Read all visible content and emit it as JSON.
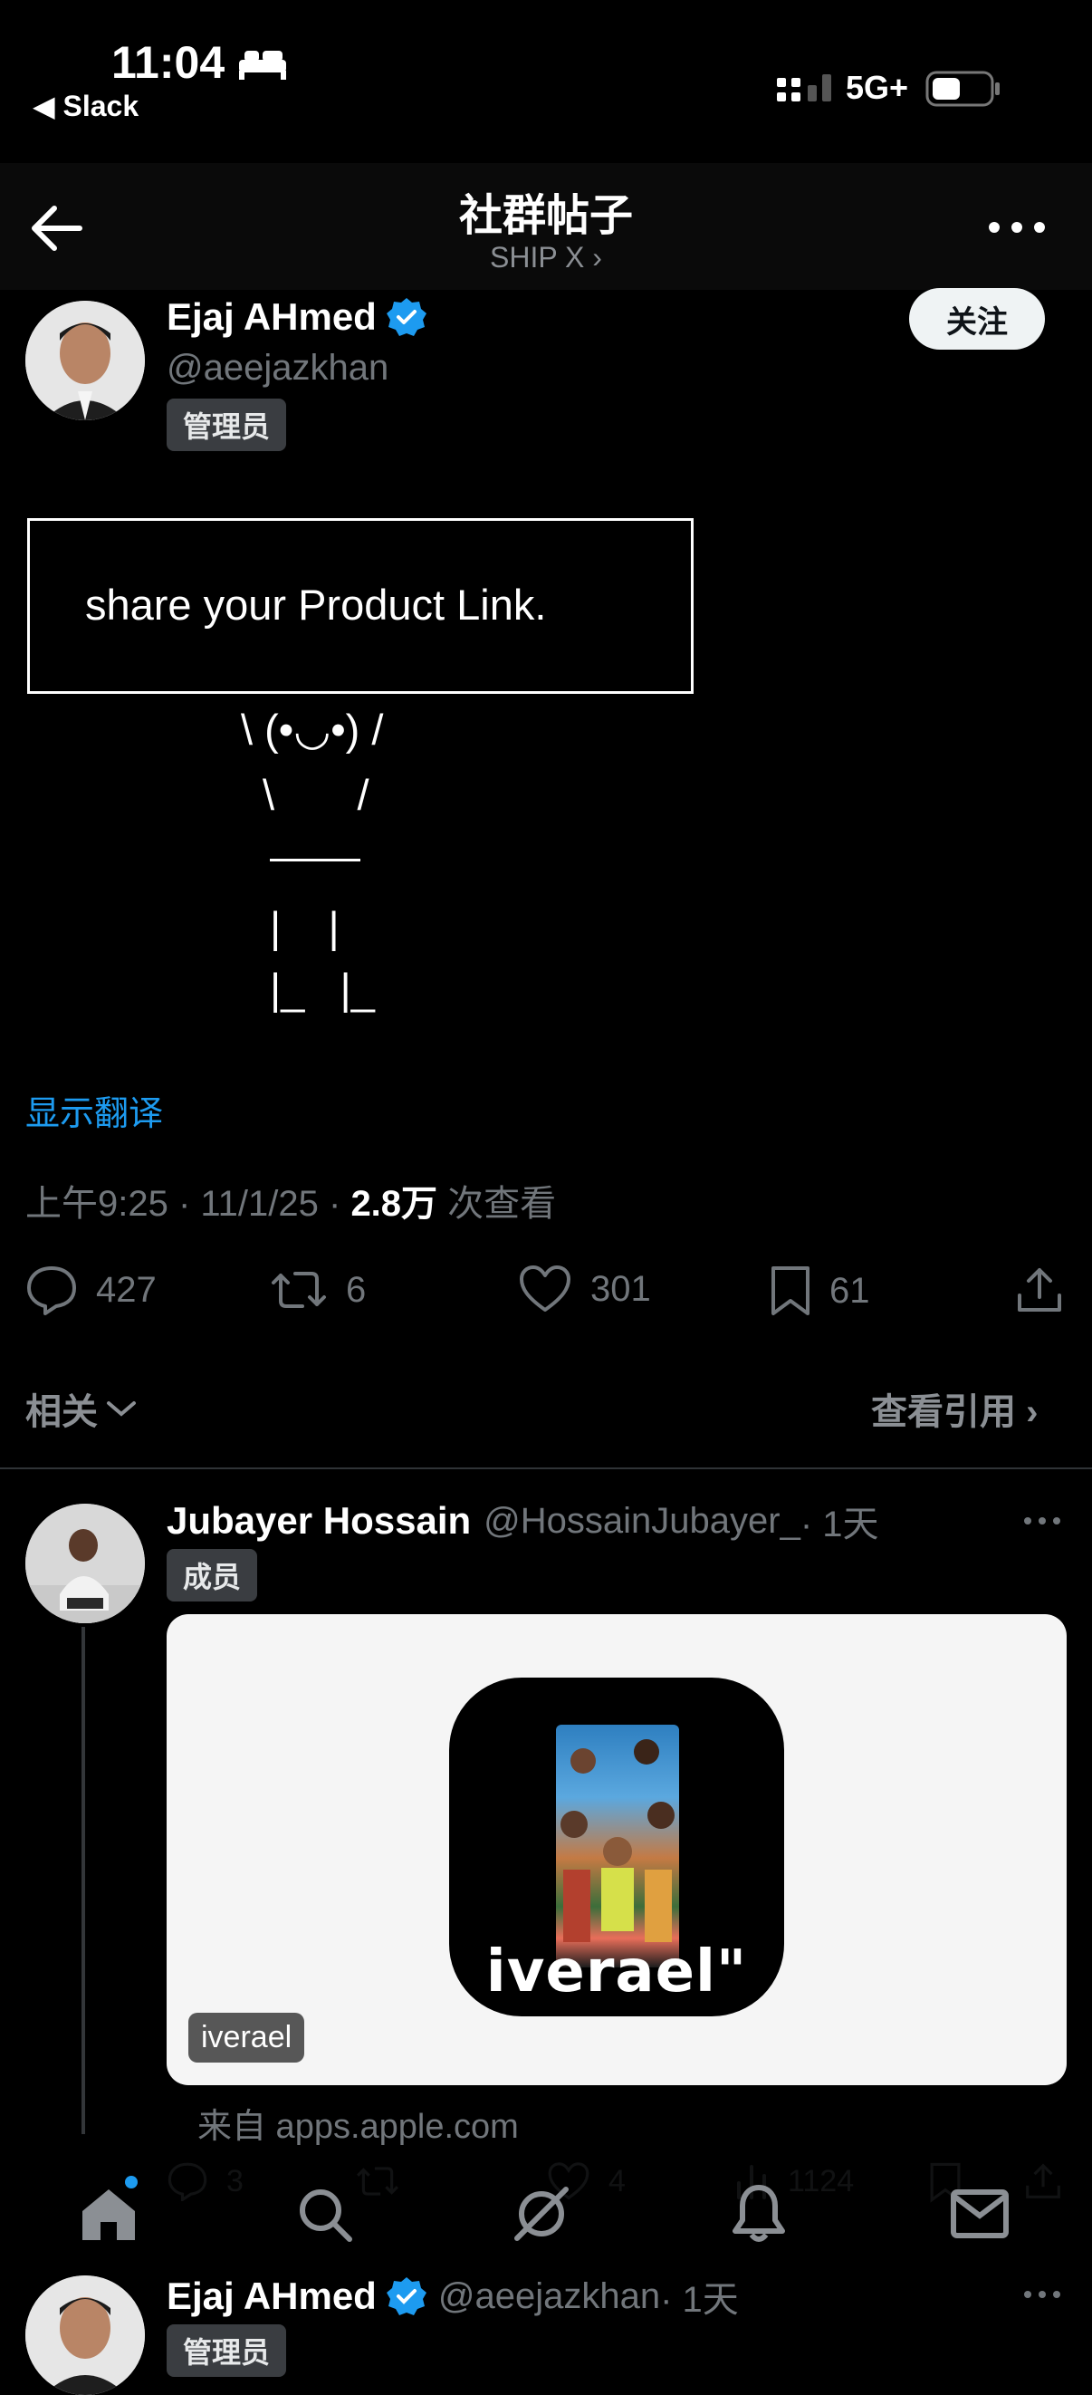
{
  "status_bar": {
    "time": "11:04",
    "back_app": "◀ Slack",
    "network": "5G+"
  },
  "nav": {
    "title": "社群帖子",
    "subtitle": "SHIP X ›"
  },
  "post": {
    "author": "Ejaj AHmed",
    "handle": "@aeejazkhan",
    "role": "管理员",
    "follow_label": "关注",
    "box_text": "share your Product Link.",
    "kaomoji": "\\ (•◡•) /",
    "arms": "\\       /",
    "legs": "|    |\n|_   |_",
    "translate": "显示翻译",
    "meta_time": "上午9:25 · 11/1/25 · ",
    "meta_views": "2.8万",
    "meta_views_label": " 次查看",
    "counts": {
      "replies": "427",
      "reposts": "6",
      "likes": "301",
      "bookmarks": "61"
    },
    "related": "相关",
    "quotes": "查看引用 ›"
  },
  "reply": {
    "author": "Jubayer Hossain",
    "handle": "@HossainJubayer_",
    "time": " · 1天",
    "role": "成员",
    "brand": "iverael\"",
    "card_label": "iverael",
    "source": "来自 apps.apple.com",
    "counts": {
      "replies": "3",
      "likes": "4",
      "views": "1124"
    }
  },
  "next_post": {
    "author": "Ejaj AHmed",
    "handle": "@aeejazkhan",
    "time": " · 1天",
    "role": "管理员"
  }
}
